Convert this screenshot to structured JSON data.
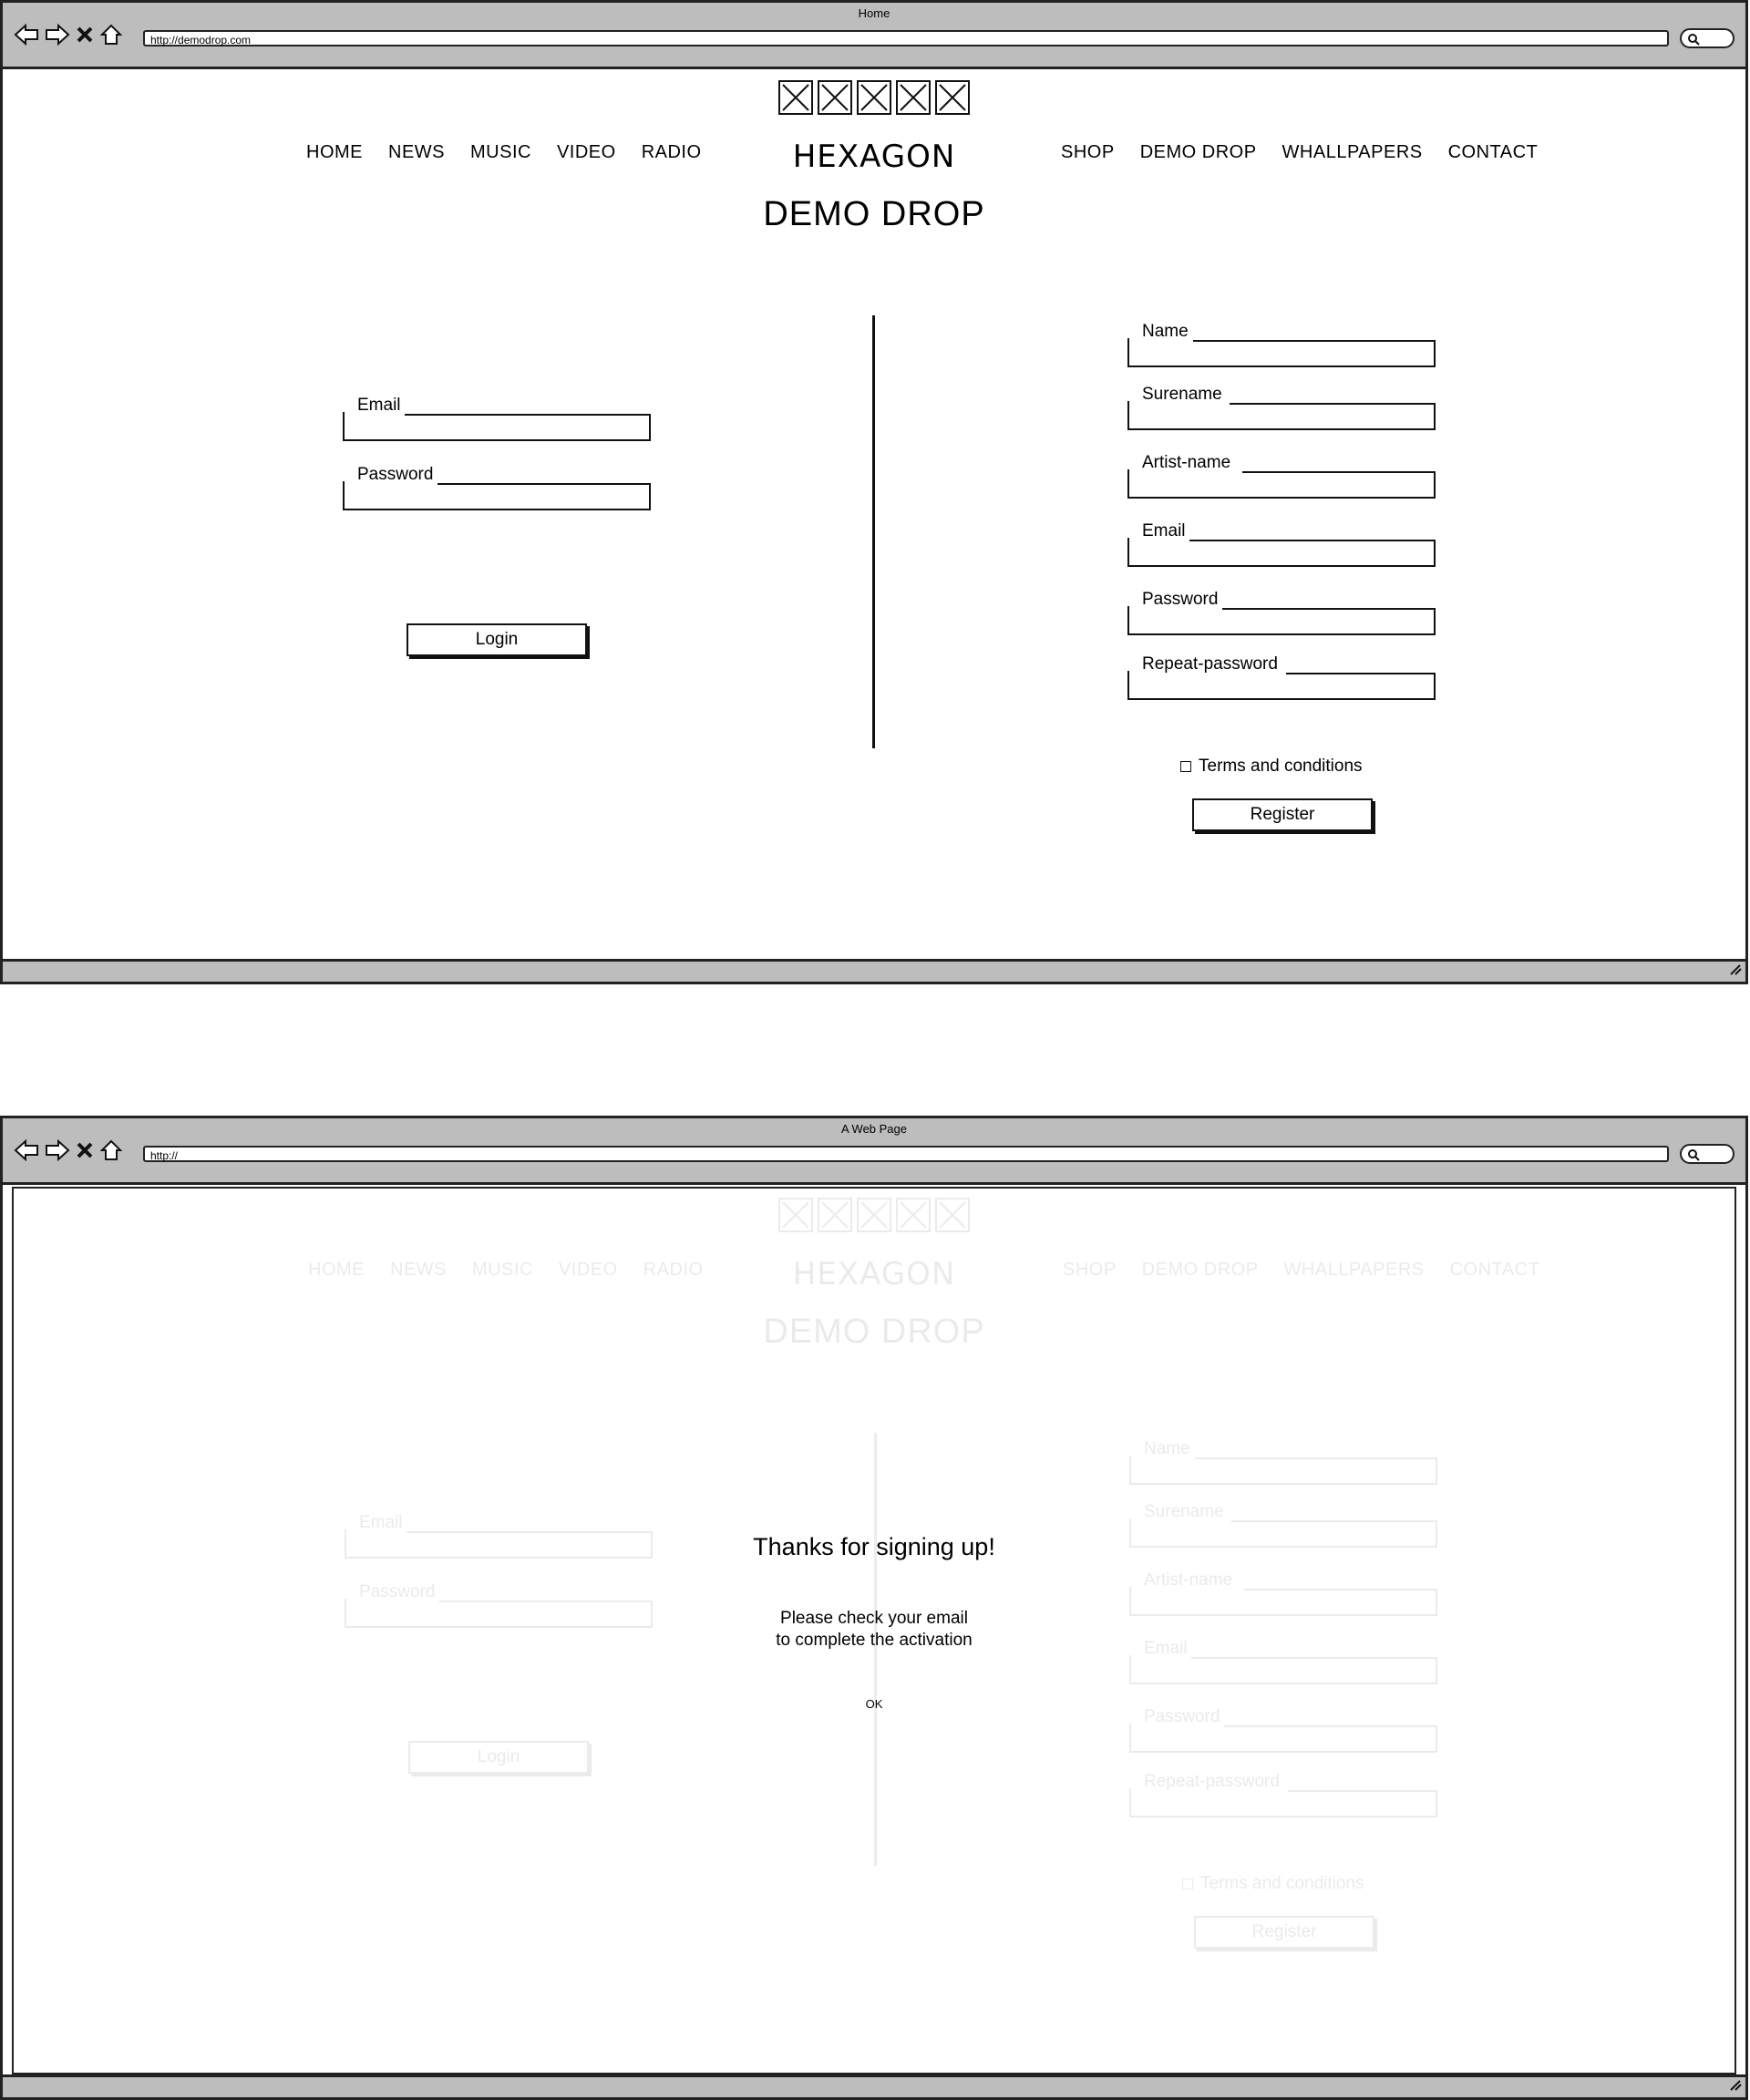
{
  "window1": {
    "title": "Home",
    "url": "http://demodrop.com"
  },
  "window2": {
    "title": "A Web Page",
    "url": "http://"
  },
  "nav": {
    "left": [
      "HOME",
      "NEWS",
      "MUSIC",
      "VIDEO",
      "RADIO"
    ],
    "right": [
      "SHOP",
      "DEMO DROP",
      "WHALLPAPERS",
      "CONTACT"
    ]
  },
  "brand": "HEXAGON",
  "page_heading": "DEMO DROP",
  "login": {
    "email_label": "Email",
    "password_label": "Password",
    "button": "Login"
  },
  "register": {
    "name_label": "Name",
    "surname_label": "Surename",
    "artist_label": "Artist-name",
    "email_label": "Email",
    "password_label": "Password",
    "repeat_label": "Repeat-password",
    "terms": "Terms and conditions",
    "button": "Register"
  },
  "modal": {
    "title": "Thanks for signing up!",
    "line1": "Please check your email",
    "line2": "to complete the activation",
    "ok": "OK"
  },
  "colors": {
    "chrome": "#bdbdbd",
    "border": "#222222"
  }
}
